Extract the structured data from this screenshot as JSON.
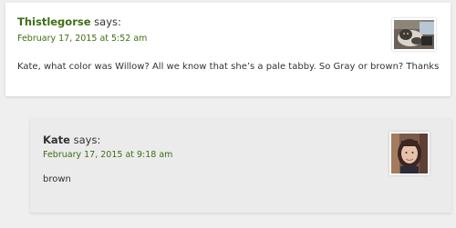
{
  "comments": [
    {
      "author": "Thistlegorse",
      "says": "says:",
      "date": "February 17, 2015 at 5:52 am",
      "text": "Kate, what color was Willow? All we know that she’s a pale tabby. So Gray or brown? Thanks",
      "avatar_icon": "cat-photo-avatar"
    },
    {
      "author": "Kate",
      "says": "says:",
      "date": "February 17, 2015 at 9:18 am",
      "text": "brown",
      "avatar_icon": "person-photo-avatar"
    }
  ],
  "colors": {
    "link_green": "#3f6d14",
    "text": "#333333",
    "reply_bg": "#ebebeb"
  }
}
